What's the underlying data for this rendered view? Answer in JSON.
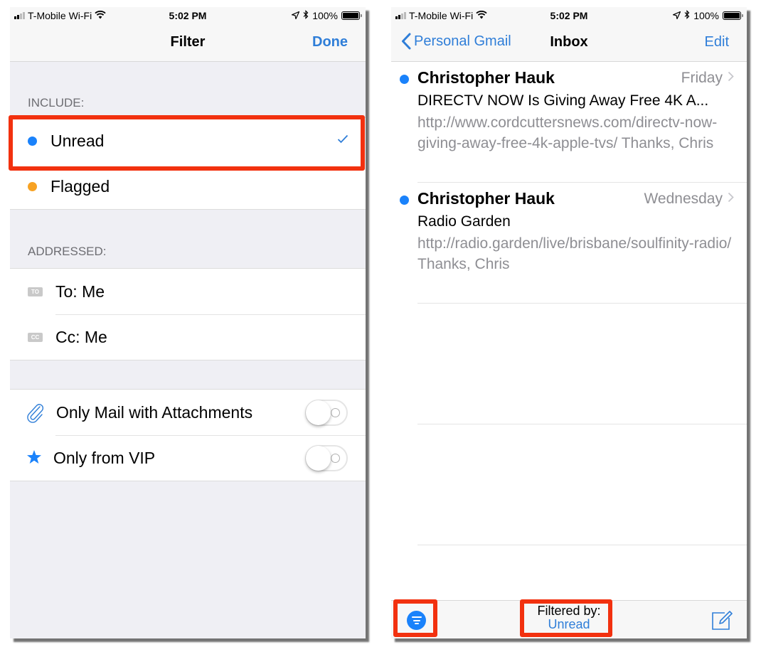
{
  "status_bar": {
    "carrier": "T-Mobile Wi-Fi",
    "time": "5:02 PM",
    "battery": "100%",
    "battery_level": 1.0
  },
  "filter_screen": {
    "title": "Filter",
    "done_label": "Done",
    "include_header": "INCLUDE:",
    "include_items": [
      {
        "label": "Unread",
        "icon": "blue-dot-icon",
        "color": "#1a82fb",
        "checked": true
      },
      {
        "label": "Flagged",
        "icon": "orange-dot-icon",
        "color": "#f7a223",
        "checked": false
      }
    ],
    "addressed_header": "ADDRESSED:",
    "addressed_items": [
      {
        "label": "To: Me",
        "badge": "TO"
      },
      {
        "label": "Cc: Me",
        "badge": "CC"
      }
    ],
    "options": [
      {
        "label": "Only Mail with Attachments",
        "icon": "paperclip-icon",
        "enabled": false
      },
      {
        "label": "Only from VIP",
        "icon": "star-icon",
        "enabled": false
      }
    ]
  },
  "inbox_screen": {
    "back_label": "Personal Gmail",
    "title": "Inbox",
    "edit_label": "Edit",
    "messages": [
      {
        "sender": "Christopher Hauk",
        "date": "Friday",
        "subject": "DIRECTV NOW Is Giving Away Free 4K A...",
        "preview": "http://www.cordcuttersnews.com/directv-now-giving-away-free-4k-apple-tvs/ Thanks, Chris",
        "unread": true
      },
      {
        "sender": "Christopher Hauk",
        "date": "Wednesday",
        "subject": "Radio Garden",
        "preview": "http://radio.garden/live/brisbane/soulfinity-radio/ Thanks, Chris",
        "unread": true
      }
    ],
    "toolbar": {
      "filtered_by_label": "Filtered by:",
      "filtered_by_value": "Unread"
    }
  },
  "colors": {
    "accent": "#2f7ed8",
    "unread_dot": "#1a82fb",
    "flag_dot": "#f7a223",
    "highlight": "#f2310f"
  }
}
